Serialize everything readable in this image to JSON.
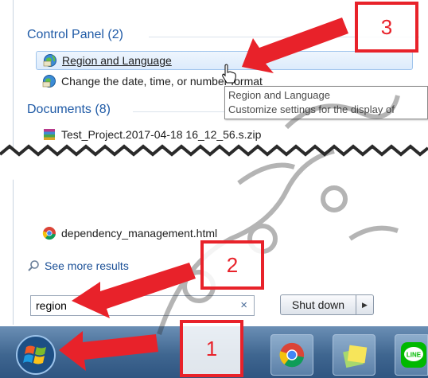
{
  "start_menu": {
    "groups": [
      {
        "header": "Control Panel (2)",
        "items": [
          {
            "label": "Region and Language",
            "icon": "region-globe-icon",
            "selected": true
          },
          {
            "label": "Change the date, time, or number format",
            "icon": "region-globe-icon"
          }
        ]
      },
      {
        "header": "Documents (8)",
        "items": [
          {
            "label": "Test_Project.2017-04-18 16_12_56.s.zip",
            "icon": "zip-archive-icon"
          },
          {
            "label": "dependency_management.html",
            "icon": "chrome-icon"
          }
        ]
      }
    ],
    "tooltip": {
      "line1": "Region and Language",
      "line2": "Customize settings for the display of"
    },
    "see_more": "See more results",
    "search": {
      "value": "region",
      "clear_glyph": "×"
    },
    "shutdown": {
      "label": "Shut down",
      "arrow_glyph": "▶"
    }
  },
  "taskbar": {
    "apps": [
      {
        "name": "start-button",
        "icon": "windows-orb-icon"
      },
      {
        "name": "chrome",
        "icon": "chrome-icon"
      },
      {
        "name": "sticky-notes",
        "icon": "sticky-notes-icon"
      },
      {
        "name": "line",
        "icon": "line-app-icon",
        "label": "LINE"
      }
    ]
  },
  "annotations": {
    "step1": "1",
    "step2": "2",
    "step3": "3",
    "accent": "#e8222a"
  }
}
